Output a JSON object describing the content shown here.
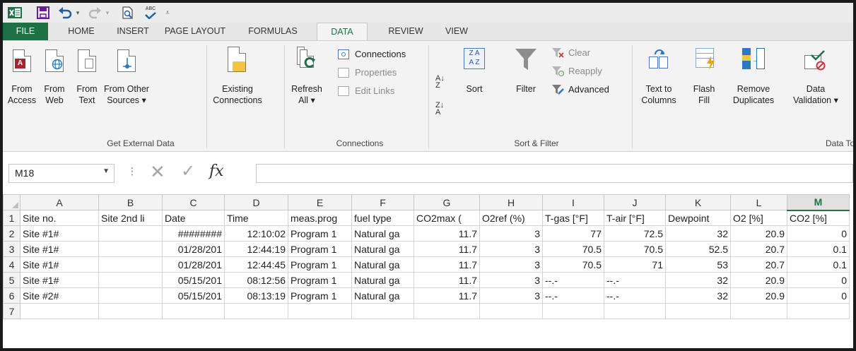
{
  "qat": {
    "abc_label": "ABC"
  },
  "tabs": [
    "FILE",
    "HOME",
    "INSERT",
    "PAGE LAYOUT",
    "FORMULAS",
    "DATA",
    "REVIEW",
    "VIEW"
  ],
  "ribbon": {
    "get_external": {
      "from_access": [
        "From",
        "Access"
      ],
      "from_web": [
        "From",
        "Web"
      ],
      "from_text": [
        "From",
        "Text"
      ],
      "from_other": [
        "From Other",
        "Sources ▾"
      ],
      "group_label": "Get External Data"
    },
    "existing": [
      "Existing",
      "Connections"
    ],
    "connections": {
      "refresh": [
        "Refresh",
        "All ▾"
      ],
      "connections": "Connections",
      "properties": "Properties",
      "edit_links": "Edit Links",
      "group_label": "Connections"
    },
    "sort_filter": {
      "sort": "Sort",
      "filter": "Filter",
      "clear": "Clear",
      "reapply": "Reapply",
      "advanced": "Advanced",
      "group_label": "Sort & Filter"
    },
    "data_tools": {
      "text_to_columns": [
        "Text to",
        "Columns"
      ],
      "flash_fill": [
        "Flash",
        "Fill"
      ],
      "remove_duplicates": [
        "Remove",
        "Duplicates"
      ],
      "data_validation": [
        "Data",
        "Validation ▾"
      ],
      "group_label": "Data To"
    }
  },
  "formula_bar": {
    "name_box": "M18",
    "fx": "fx",
    "value": ""
  },
  "colors": {
    "excel_green": "#217346",
    "ribbon_bg": "#f3f3f3",
    "header_bg": "#f3f3f3"
  },
  "sheet": {
    "columns": [
      "A",
      "B",
      "C",
      "D",
      "E",
      "F",
      "G",
      "H",
      "I",
      "J",
      "K",
      "L",
      "M"
    ],
    "selected_column": "M",
    "rows": [
      {
        "num": "1",
        "cells": [
          "Site no.",
          "Site 2nd li",
          "Date",
          "Time",
          "meas.prog",
          "fuel type",
          "CO2max (",
          "O2ref (%)",
          "T-gas [°F]",
          "T-air [°F]",
          "Dewpoint",
          "O2 [%]",
          "CO2 [%]"
        ]
      },
      {
        "num": "2",
        "cells": [
          "Site #1#",
          "",
          "########",
          "12:10:02",
          "Program 1",
          "Natural ga",
          "11.7",
          "3",
          "77",
          "72.5",
          "32",
          "20.9",
          "0"
        ]
      },
      {
        "num": "3",
        "cells": [
          "Site #1#",
          "",
          "01/28/201",
          "12:44:19",
          "Program 1",
          "Natural ga",
          "11.7",
          "3",
          "70.5",
          "70.5",
          "52.5",
          "20.7",
          "0.1"
        ]
      },
      {
        "num": "4",
        "cells": [
          "Site #1#",
          "",
          "01/28/201",
          "12:44:45",
          "Program 1",
          "Natural ga",
          "11.7",
          "3",
          "70.5",
          "71",
          "53",
          "20.7",
          "0.1"
        ]
      },
      {
        "num": "5",
        "cells": [
          "Site #1#",
          "",
          "05/15/201",
          "08:12:56",
          "Program 1",
          "Natural ga",
          "11.7",
          "3",
          "--.-",
          "--.-",
          "32",
          "20.9",
          "0"
        ]
      },
      {
        "num": "6",
        "cells": [
          "Site #2#",
          "",
          "05/15/201",
          "08:13:19",
          "Program 1",
          "Natural ga",
          "11.7",
          "3",
          "--.-",
          "--.-",
          "32",
          "20.9",
          "0"
        ]
      },
      {
        "num": "7",
        "cells": [
          "",
          "",
          "",
          "",
          "",
          "",
          "",
          "",
          "",
          "",
          "",
          "",
          ""
        ]
      }
    ]
  }
}
